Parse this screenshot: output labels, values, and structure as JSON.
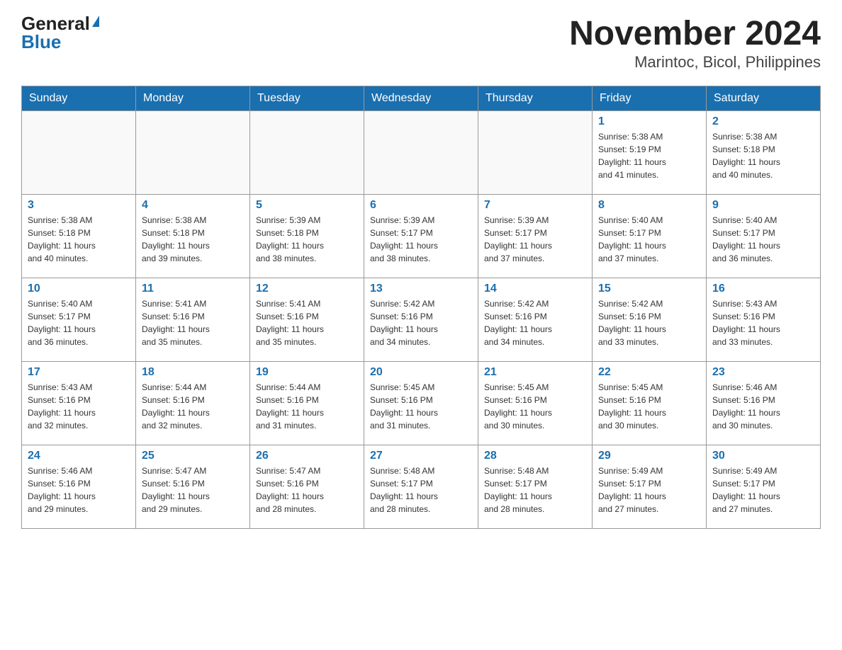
{
  "header": {
    "logo_general": "General",
    "logo_blue": "Blue",
    "title": "November 2024",
    "subtitle": "Marintoc, Bicol, Philippines"
  },
  "weekdays": [
    "Sunday",
    "Monday",
    "Tuesday",
    "Wednesday",
    "Thursday",
    "Friday",
    "Saturday"
  ],
  "weeks": [
    [
      {
        "day": "",
        "info": ""
      },
      {
        "day": "",
        "info": ""
      },
      {
        "day": "",
        "info": ""
      },
      {
        "day": "",
        "info": ""
      },
      {
        "day": "",
        "info": ""
      },
      {
        "day": "1",
        "info": "Sunrise: 5:38 AM\nSunset: 5:19 PM\nDaylight: 11 hours\nand 41 minutes."
      },
      {
        "day": "2",
        "info": "Sunrise: 5:38 AM\nSunset: 5:18 PM\nDaylight: 11 hours\nand 40 minutes."
      }
    ],
    [
      {
        "day": "3",
        "info": "Sunrise: 5:38 AM\nSunset: 5:18 PM\nDaylight: 11 hours\nand 40 minutes."
      },
      {
        "day": "4",
        "info": "Sunrise: 5:38 AM\nSunset: 5:18 PM\nDaylight: 11 hours\nand 39 minutes."
      },
      {
        "day": "5",
        "info": "Sunrise: 5:39 AM\nSunset: 5:18 PM\nDaylight: 11 hours\nand 38 minutes."
      },
      {
        "day": "6",
        "info": "Sunrise: 5:39 AM\nSunset: 5:17 PM\nDaylight: 11 hours\nand 38 minutes."
      },
      {
        "day": "7",
        "info": "Sunrise: 5:39 AM\nSunset: 5:17 PM\nDaylight: 11 hours\nand 37 minutes."
      },
      {
        "day": "8",
        "info": "Sunrise: 5:40 AM\nSunset: 5:17 PM\nDaylight: 11 hours\nand 37 minutes."
      },
      {
        "day": "9",
        "info": "Sunrise: 5:40 AM\nSunset: 5:17 PM\nDaylight: 11 hours\nand 36 minutes."
      }
    ],
    [
      {
        "day": "10",
        "info": "Sunrise: 5:40 AM\nSunset: 5:17 PM\nDaylight: 11 hours\nand 36 minutes."
      },
      {
        "day": "11",
        "info": "Sunrise: 5:41 AM\nSunset: 5:16 PM\nDaylight: 11 hours\nand 35 minutes."
      },
      {
        "day": "12",
        "info": "Sunrise: 5:41 AM\nSunset: 5:16 PM\nDaylight: 11 hours\nand 35 minutes."
      },
      {
        "day": "13",
        "info": "Sunrise: 5:42 AM\nSunset: 5:16 PM\nDaylight: 11 hours\nand 34 minutes."
      },
      {
        "day": "14",
        "info": "Sunrise: 5:42 AM\nSunset: 5:16 PM\nDaylight: 11 hours\nand 34 minutes."
      },
      {
        "day": "15",
        "info": "Sunrise: 5:42 AM\nSunset: 5:16 PM\nDaylight: 11 hours\nand 33 minutes."
      },
      {
        "day": "16",
        "info": "Sunrise: 5:43 AM\nSunset: 5:16 PM\nDaylight: 11 hours\nand 33 minutes."
      }
    ],
    [
      {
        "day": "17",
        "info": "Sunrise: 5:43 AM\nSunset: 5:16 PM\nDaylight: 11 hours\nand 32 minutes."
      },
      {
        "day": "18",
        "info": "Sunrise: 5:44 AM\nSunset: 5:16 PM\nDaylight: 11 hours\nand 32 minutes."
      },
      {
        "day": "19",
        "info": "Sunrise: 5:44 AM\nSunset: 5:16 PM\nDaylight: 11 hours\nand 31 minutes."
      },
      {
        "day": "20",
        "info": "Sunrise: 5:45 AM\nSunset: 5:16 PM\nDaylight: 11 hours\nand 31 minutes."
      },
      {
        "day": "21",
        "info": "Sunrise: 5:45 AM\nSunset: 5:16 PM\nDaylight: 11 hours\nand 30 minutes."
      },
      {
        "day": "22",
        "info": "Sunrise: 5:45 AM\nSunset: 5:16 PM\nDaylight: 11 hours\nand 30 minutes."
      },
      {
        "day": "23",
        "info": "Sunrise: 5:46 AM\nSunset: 5:16 PM\nDaylight: 11 hours\nand 30 minutes."
      }
    ],
    [
      {
        "day": "24",
        "info": "Sunrise: 5:46 AM\nSunset: 5:16 PM\nDaylight: 11 hours\nand 29 minutes."
      },
      {
        "day": "25",
        "info": "Sunrise: 5:47 AM\nSunset: 5:16 PM\nDaylight: 11 hours\nand 29 minutes."
      },
      {
        "day": "26",
        "info": "Sunrise: 5:47 AM\nSunset: 5:16 PM\nDaylight: 11 hours\nand 28 minutes."
      },
      {
        "day": "27",
        "info": "Sunrise: 5:48 AM\nSunset: 5:17 PM\nDaylight: 11 hours\nand 28 minutes."
      },
      {
        "day": "28",
        "info": "Sunrise: 5:48 AM\nSunset: 5:17 PM\nDaylight: 11 hours\nand 28 minutes."
      },
      {
        "day": "29",
        "info": "Sunrise: 5:49 AM\nSunset: 5:17 PM\nDaylight: 11 hours\nand 27 minutes."
      },
      {
        "day": "30",
        "info": "Sunrise: 5:49 AM\nSunset: 5:17 PM\nDaylight: 11 hours\nand 27 minutes."
      }
    ]
  ]
}
